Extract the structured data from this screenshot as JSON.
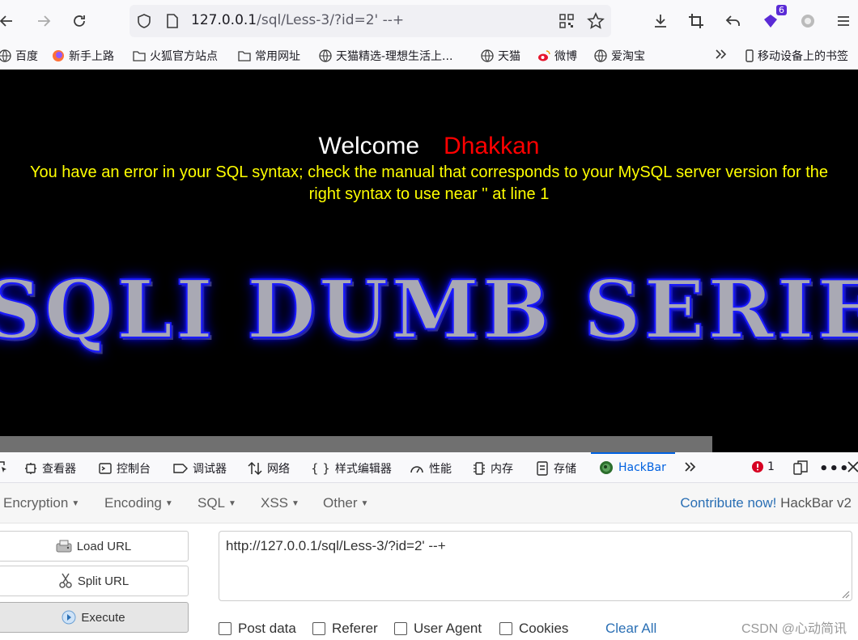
{
  "browser": {
    "url_host": "127.0.0.1",
    "url_path": "/sql/Less-3/?id=2' --+",
    "extension_badge": "6"
  },
  "bookmarks": [
    {
      "label": "百度",
      "icon": "globe-icon"
    },
    {
      "label": "新手上路",
      "icon": "firefox-icon"
    },
    {
      "label": "火狐官方站点",
      "icon": "folder-icon"
    },
    {
      "label": "常用网址",
      "icon": "folder-icon"
    },
    {
      "label": "天猫精选-理想生活上...",
      "icon": "globe-icon"
    },
    {
      "label": "天猫",
      "icon": "globe-icon"
    },
    {
      "label": "微博",
      "icon": "weibo-icon"
    },
    {
      "label": "爱淘宝",
      "icon": "globe-icon"
    },
    {
      "label": "移动设备上的书签",
      "icon": "mobile-icon"
    }
  ],
  "page": {
    "welcome": "Welcome",
    "name": "Dhakkan",
    "error_line1": "You have an error in your SQL syntax; check the manual that corresponds to your MySQL server version for the",
    "error_line2": "right syntax to use near '' at line 1",
    "logo_text": "SQLI DUMB SERIES"
  },
  "devtools": {
    "tabs": [
      "查看器",
      "控制台",
      "调试器",
      "网络",
      "样式编辑器",
      "性能",
      "内存",
      "存储",
      "HackBar"
    ],
    "error_count": "1"
  },
  "hackbar": {
    "menus": [
      "Encryption",
      "Encoding",
      "SQL",
      "XSS",
      "Other"
    ],
    "contribute_link": "Contribute now!",
    "version": "HackBar v2",
    "load_url": "Load URL",
    "split_url": "Split URL",
    "execute": "Execute",
    "url_value": "http://127.0.0.1/sql/Less-3/?id=2' --+",
    "options": [
      "Post data",
      "Referer",
      "User Agent",
      "Cookies"
    ],
    "clear_all": "Clear All"
  },
  "watermark": "CSDN @心动简讯"
}
